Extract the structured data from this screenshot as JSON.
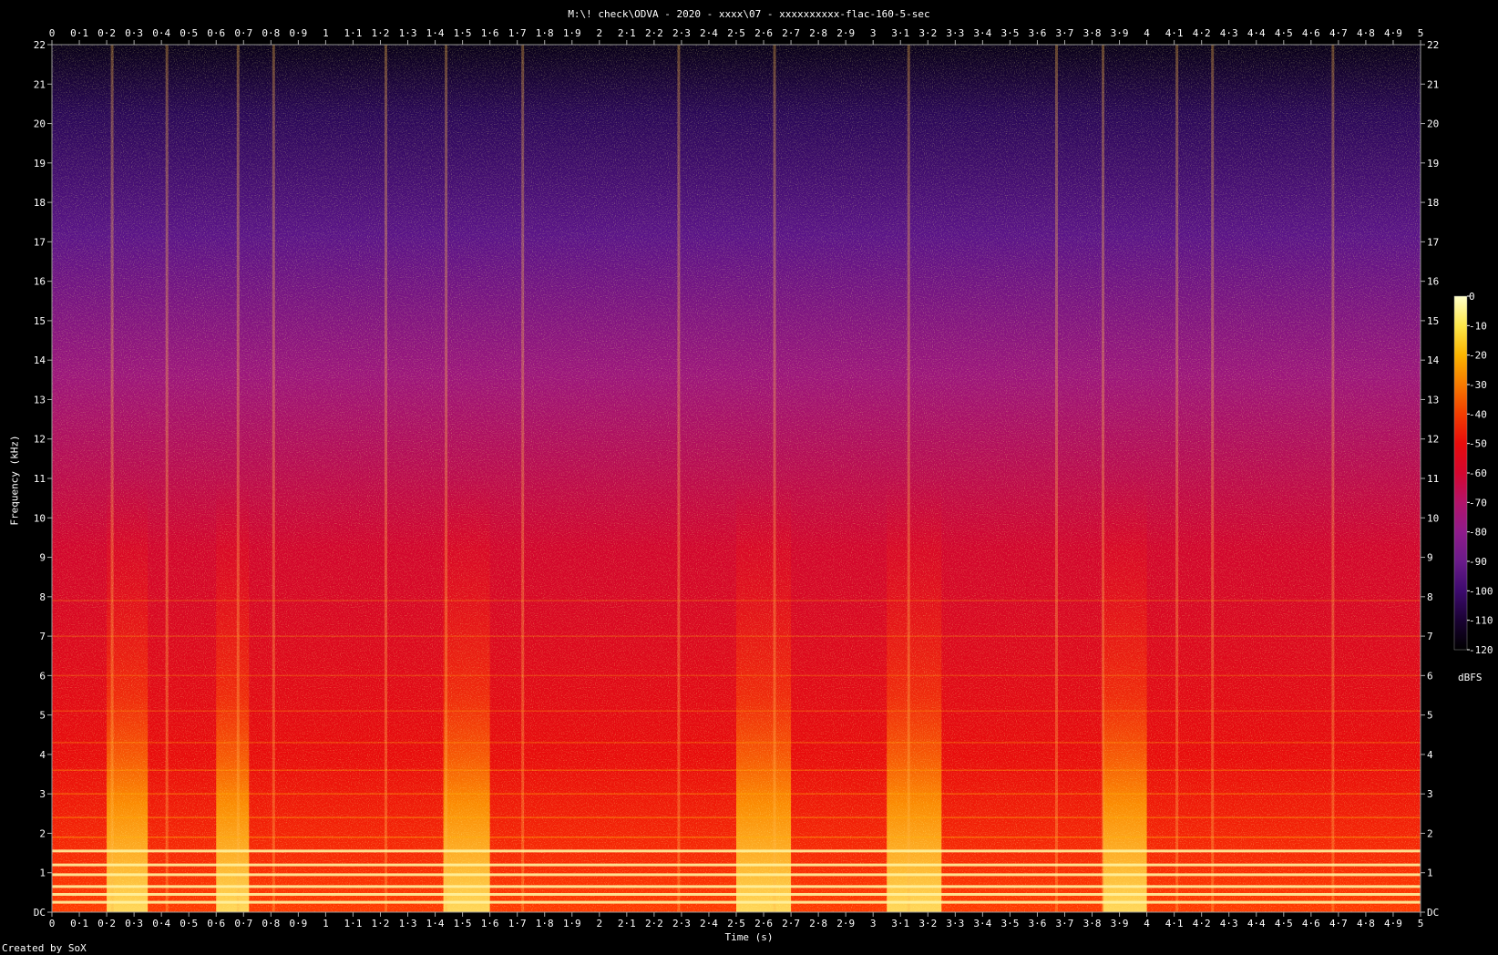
{
  "title": "M:\\! check\\ODVA - 2020 - xxxx\\07 - xxxxxxxxxx-flac-160-5-sec",
  "credit": "Created by SoX",
  "chart_data": {
    "type": "heatmap",
    "title": "M:\\! check\\ODVA - 2020 - xxxx\\07 - xxxxxxxxxx-flac-160-5-sec",
    "xlabel": "Time (s)",
    "ylabel": "Frequency (kHz)",
    "xlim": [
      0,
      5
    ],
    "ylim": [
      0,
      22
    ],
    "x_ticks": [
      "0",
      "0·1",
      "0·2",
      "0·3",
      "0·4",
      "0·5",
      "0·6",
      "0·7",
      "0·8",
      "0·9",
      "1",
      "1·1",
      "1·2",
      "1·3",
      "1·4",
      "1·5",
      "1·6",
      "1·7",
      "1·8",
      "1·9",
      "2",
      "2·1",
      "2·2",
      "2·3",
      "2·4",
      "2·5",
      "2·6",
      "2·7",
      "2·8",
      "2·9",
      "3",
      "3·1",
      "3·2",
      "3·3",
      "3·4",
      "3·5",
      "3·6",
      "3·7",
      "3·8",
      "3·9",
      "4",
      "4·1",
      "4·2",
      "4·3",
      "4·4",
      "4·5",
      "4·6",
      "4·7",
      "4·8",
      "4·9",
      "5"
    ],
    "y_ticks": [
      "DC",
      "1",
      "2",
      "3",
      "4",
      "5",
      "6",
      "7",
      "8",
      "9",
      "10",
      "11",
      "12",
      "13",
      "14",
      "15",
      "16",
      "17",
      "18",
      "19",
      "20",
      "21",
      "22"
    ],
    "colorbar": {
      "label": "dBFS",
      "range": [
        -120,
        0
      ],
      "ticks": [
        "0",
        "-10",
        "-20",
        "-30",
        "-40",
        "-50",
        "-60",
        "-70",
        "-80",
        "-90",
        "-100",
        "-110",
        "-120"
      ],
      "colors": [
        "#000000",
        "#1a0233",
        "#3d0a6e",
        "#6a1b8a",
        "#8f1b8b",
        "#b3136a",
        "#d5062f",
        "#e80c0c",
        "#f23d00",
        "#f77a00",
        "#fbb400",
        "#fde74a",
        "#ffffc8"
      ]
    },
    "onsets_s": [
      0.22,
      0.42,
      0.68,
      0.81,
      1.22,
      1.44,
      1.72,
      2.29,
      2.64,
      3.13,
      3.67,
      3.84,
      4.11,
      4.24,
      4.68
    ],
    "bright_bursts_s": [
      [
        0.2,
        0.35
      ],
      [
        0.6,
        0.72
      ],
      [
        1.43,
        1.6
      ],
      [
        2.5,
        2.7
      ],
      [
        3.05,
        3.25
      ],
      [
        3.84,
        4.0
      ]
    ],
    "harmonic_lines_khz": [
      0.25,
      0.45,
      0.65,
      0.95,
      1.2,
      1.55,
      1.9,
      2.4,
      3.0,
      3.6,
      4.3,
      5.1,
      6.0,
      7.0,
      7.9
    ]
  }
}
